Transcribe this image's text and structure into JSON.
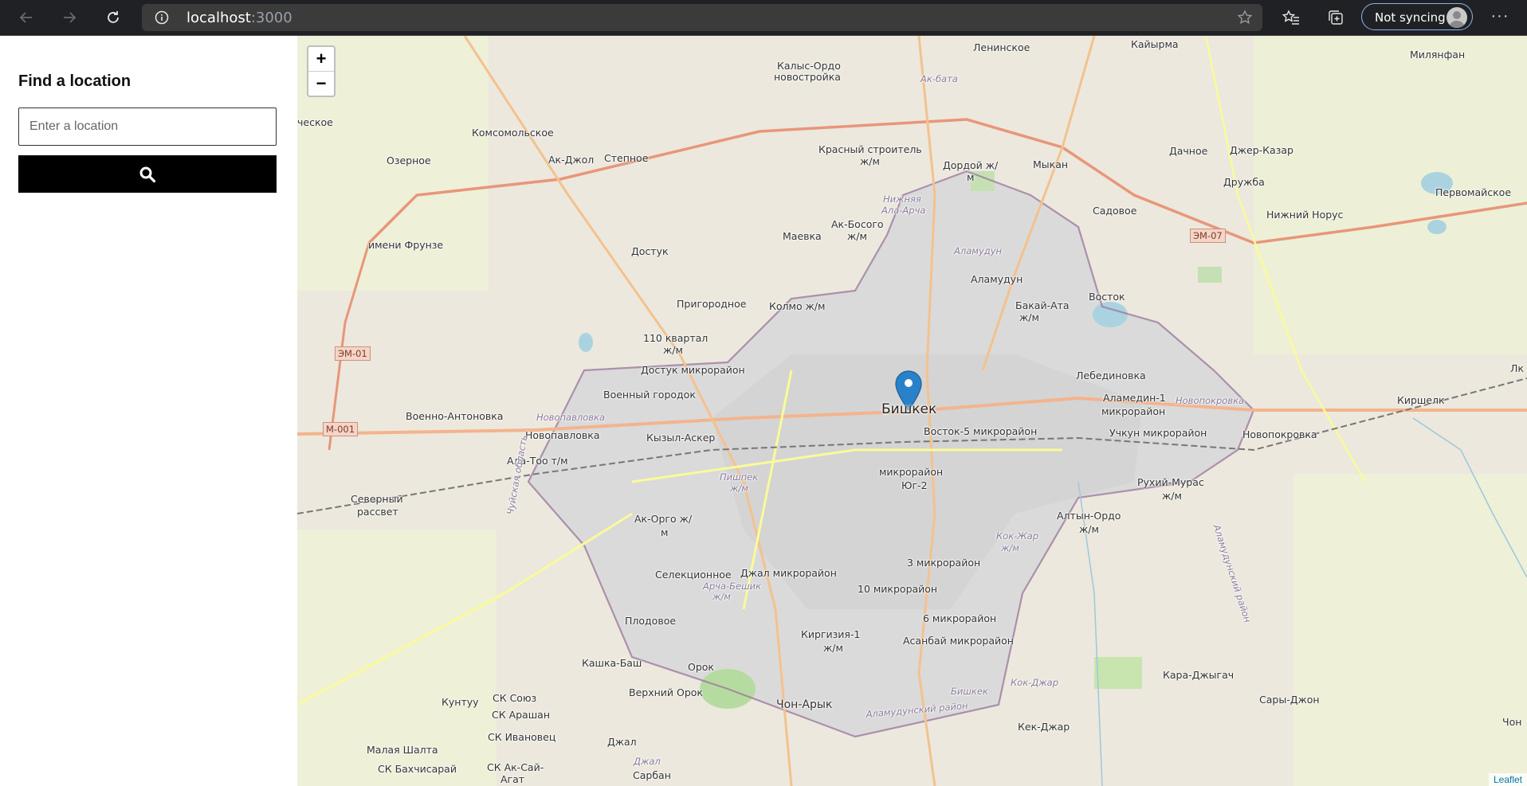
{
  "browser": {
    "url_host": "localhost",
    "url_port": ":3000",
    "sync_label": "Not syncing"
  },
  "sidebar": {
    "title": "Find a location",
    "search_placeholder": "Enter a location"
  },
  "map": {
    "zoom_in": "+",
    "zoom_out": "−",
    "attribution": "Leaflet",
    "labels": {
      "bishkek": "Бишкек",
      "leninskoe": "Ленинское",
      "kayirma": "Кайырма",
      "milyanfan": "Милянфан",
      "kalys": "Калыс-Ордо",
      "novostroyka": "новостройка",
      "ak_bata": "Ак-бата",
      "eskoe": "ческое",
      "komsomolskoe": "Комсомольское",
      "ak_jol": "Ак-Джол",
      "stepnoe": "Степное",
      "ozernoe": "Озерное",
      "krasny1": "Красный строитель",
      "krasny2": "ж/м",
      "dordoy1": "Дордой ж/",
      "dordoy2": "м",
      "mykan": "Мыкан",
      "dachnoe": "Дачное",
      "jer_kazar": "Джер-Казар",
      "druzhba": "Дружба",
      "pervomayskoe": "Первомайское",
      "nizhny_alaarcha1": "Нижняя",
      "nizhny_alaarcha2": "Ала-Арча",
      "sadovoe": "Садовое",
      "nizhny_norus": "Нижний Норус",
      "em07": "ЭМ-07",
      "imeni_frunze": "имени Фрунзе",
      "maevka": "Маевка",
      "ak_bosogo1": "Ак-Босого",
      "ak_bosogo2": "ж/м",
      "dostuk": "Достук",
      "alamudun_it": "Аламудун",
      "alamudun": "Аламудун",
      "prigorodnoe": "Пригородное",
      "kolmo": "Колмо ж/м",
      "bakai1": "Бакай-Ата",
      "bakai2": "ж/м",
      "vostok": "Восток",
      "em01": "ЭМ-01",
      "kvartal1": "110 квартал",
      "kvartal2": "ж/м",
      "dostuk_mkr": "Достук микрорайон",
      "lebedinovka": "Лебединовка",
      "voenny": "Военный городок",
      "alamedin1": "Аламедин-1",
      "alamedin2": "микрорайон",
      "novopokrovka_it": "Новопокровка",
      "kirshelk": "Киршелк",
      "m001": "М-001",
      "voenno_ant": "Военно-Антоновка",
      "novopavlovka_it": "Новопавловка",
      "novopavlovka": "Новопавловка",
      "kyzyl_asker": "Кызыл-Аскер",
      "vostok5": "Восток-5 микрорайон",
      "uchkun": "Учкун микрорайон",
      "novopokrovka": "Новопокровка",
      "ala_too": "Ала-Тоо т/м",
      "pishpek1": "Пишпек",
      "pishpek2": "ж/м",
      "mkr_yug1": "микрорайон",
      "mkr_yug2": "Юг-2",
      "rukhiy1": "Рухий-Мурас",
      "rukhiy2": "ж/м",
      "severny1": "Северный",
      "severny2": "рассвет",
      "chui_obl": "Чуйская область",
      "ak_orgo1": "Ак-Орго ж/",
      "ak_orgo2": "м",
      "altyn1": "Алтын-Ордо",
      "altyn2": "ж/м",
      "kok_jar1": "Кок-Жар",
      "kok_jar2": "ж/м",
      "alamudun_rayon": "Аламудунский район",
      "mkr3": "3 микрорайон",
      "selektsionnoe": "Селекционное",
      "jal": "Джал микрорайон",
      "arch_beshik1": "Арча-Бешик",
      "arch_beshik2": "ж/м",
      "mkr10": "10 микрорайон",
      "plodovoe": "Плодовое",
      "mkr6": "6 микрорайон",
      "kirgizia1": "Киргизия-1",
      "kirgizia2": "ж/м",
      "asanbai": "Асанбай микрорайон",
      "kashka": "Кашка-Баш",
      "orok": "Орок",
      "kara_jygach": "Кара-Джыгач",
      "verkhny_orok": "Верхний Орок",
      "bishkek_it": "Бишкек",
      "kok_jar_it": "Кок-Джар",
      "kuntuu": "Кунтуу",
      "sk_soyuz": "СК Союз",
      "chon_aryk": "Чон-Арык",
      "saray_jon": "Сары-Джон",
      "sk_arashan": "СК Арашан",
      "alamud_rayon2": "Аламудунский район",
      "sk_ivanovets": "СК Ивановец",
      "kek_jar": "Кек-Джар",
      "chon": "Чон",
      "malaya": "Малая Шалта",
      "jal2": "Джал",
      "jal_it": "Джал",
      "sk_bakh": "СК Бахчисарай",
      "sk_ak_sai1": "СК Ак-Сай-",
      "sk_ak_sai2": "Агат",
      "sarban": "Сарбан",
      "lk": "Лк"
    }
  }
}
